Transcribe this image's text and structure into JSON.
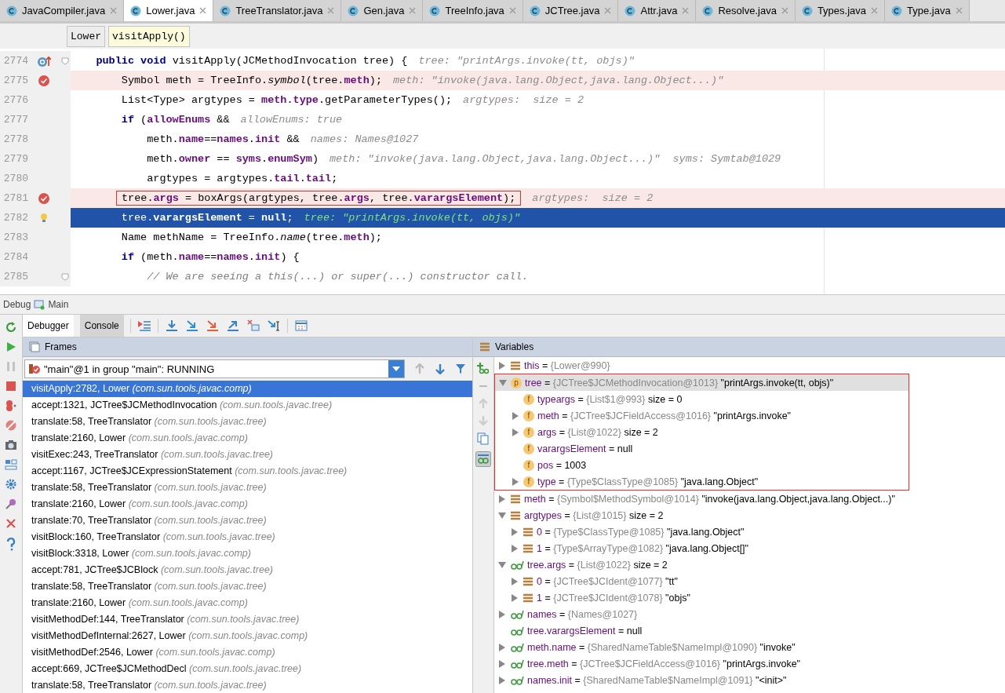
{
  "tabs": [
    {
      "label": "JavaCompiler.java",
      "selected": false
    },
    {
      "label": "Lower.java",
      "selected": true
    },
    {
      "label": "TreeTranslator.java",
      "selected": false
    },
    {
      "label": "Gen.java",
      "selected": false
    },
    {
      "label": "TreeInfo.java",
      "selected": false
    },
    {
      "label": "JCTree.java",
      "selected": false
    },
    {
      "label": "Attr.java",
      "selected": false
    },
    {
      "label": "Resolve.java",
      "selected": false
    },
    {
      "label": "Types.java",
      "selected": false
    },
    {
      "label": "Type.java",
      "selected": false
    }
  ],
  "breadcrumbs": [
    {
      "label": "Lower",
      "selected": false
    },
    {
      "label": "visitApply()",
      "selected": true
    }
  ],
  "code_lines": [
    {
      "number": "2774",
      "override": true,
      "breakpoint": false,
      "bulb": false,
      "current": false,
      "fold": true,
      "boxed": false,
      "segments": [
        {
          "t": "    public void",
          "kind": "kw"
        },
        {
          "t": " visitApply(JCMethodInvocation tree) {",
          "kind": "plain"
        }
      ],
      "hint": "tree: \"printArgs.invoke(tt, objs)\""
    },
    {
      "number": "2775",
      "override": false,
      "breakpoint": true,
      "bulb": false,
      "current": false,
      "fold": false,
      "boxed": false,
      "segments": [
        {
          "t": "        Symbol meth = TreeInfo.",
          "kind": "plain"
        },
        {
          "t": "symbol",
          "kind": "static"
        },
        {
          "t": "(tree.",
          "kind": "plain"
        },
        {
          "t": "meth",
          "kind": "field"
        },
        {
          "t": ");",
          "kind": "plain"
        }
      ],
      "hint": "meth: \"invoke(java.lang.Object,java.lang.Object...)\""
    },
    {
      "number": "2776",
      "override": false,
      "breakpoint": false,
      "bulb": false,
      "current": false,
      "fold": false,
      "boxed": false,
      "segments": [
        {
          "t": "        List<Type> argtypes = ",
          "kind": "plain"
        },
        {
          "t": "meth",
          "kind": "field"
        },
        {
          "t": ".",
          "kind": "plain"
        },
        {
          "t": "type",
          "kind": "field"
        },
        {
          "t": ".getParameterTypes();",
          "kind": "plain"
        }
      ],
      "hint": "argtypes:  size = 2"
    },
    {
      "number": "2777",
      "override": false,
      "breakpoint": false,
      "bulb": false,
      "current": false,
      "fold": false,
      "boxed": false,
      "segments": [
        {
          "t": "        if",
          "kind": "kw"
        },
        {
          "t": " (",
          "kind": "plain"
        },
        {
          "t": "allowEnums",
          "kind": "field"
        },
        {
          "t": " &&",
          "kind": "plain"
        }
      ],
      "hint": "allowEnums: true"
    },
    {
      "number": "2778",
      "override": false,
      "breakpoint": false,
      "bulb": false,
      "current": false,
      "fold": false,
      "boxed": false,
      "segments": [
        {
          "t": "            meth.",
          "kind": "plain"
        },
        {
          "t": "name",
          "kind": "field"
        },
        {
          "t": "==",
          "kind": "plain"
        },
        {
          "t": "names",
          "kind": "field"
        },
        {
          "t": ".",
          "kind": "plain"
        },
        {
          "t": "init",
          "kind": "field"
        },
        {
          "t": " &&",
          "kind": "plain"
        }
      ],
      "hint": "names: Names@1027"
    },
    {
      "number": "2779",
      "override": false,
      "breakpoint": false,
      "bulb": false,
      "current": false,
      "fold": false,
      "boxed": false,
      "segments": [
        {
          "t": "            meth.",
          "kind": "plain"
        },
        {
          "t": "owner",
          "kind": "field"
        },
        {
          "t": " == ",
          "kind": "plain"
        },
        {
          "t": "syms",
          "kind": "field"
        },
        {
          "t": ".",
          "kind": "plain"
        },
        {
          "t": "enumSym",
          "kind": "field"
        },
        {
          "t": ")",
          "kind": "plain"
        }
      ],
      "hint": "meth: \"invoke(java.lang.Object,java.lang.Object...)\"  syms: Symtab@1029"
    },
    {
      "number": "2780",
      "override": false,
      "breakpoint": false,
      "bulb": false,
      "current": false,
      "fold": false,
      "boxed": false,
      "segments": [
        {
          "t": "            argtypes = argtypes.",
          "kind": "plain"
        },
        {
          "t": "tail",
          "kind": "field"
        },
        {
          "t": ".",
          "kind": "plain"
        },
        {
          "t": "tail",
          "kind": "field"
        },
        {
          "t": ";",
          "kind": "plain"
        }
      ]
    },
    {
      "number": "2781",
      "override": false,
      "breakpoint": true,
      "bulb": false,
      "current": false,
      "fold": false,
      "boxed": true,
      "segments": [
        {
          "t": "tree.",
          "kind": "plain"
        },
        {
          "t": "args",
          "kind": "field"
        },
        {
          "t": " = boxArgs(argtypes, tree.",
          "kind": "plain"
        },
        {
          "t": "args",
          "kind": "field"
        },
        {
          "t": ", tree.",
          "kind": "plain"
        },
        {
          "t": "varargsElement",
          "kind": "field"
        },
        {
          "t": ");",
          "kind": "plain"
        }
      ],
      "hint": "argtypes:  size = 2"
    },
    {
      "number": "2782",
      "override": false,
      "breakpoint": false,
      "bulb": true,
      "current": true,
      "fold": false,
      "boxed": false,
      "segments": [
        {
          "t": "        tree.",
          "kind": "plain"
        },
        {
          "t": "varargsElement",
          "kind": "field"
        },
        {
          "t": " = ",
          "kind": "plain"
        },
        {
          "t": "null",
          "kind": "kw"
        },
        {
          "t": ";",
          "kind": "plain"
        }
      ],
      "hint": "tree: \"printArgs.invoke(tt, objs)\""
    },
    {
      "number": "2783",
      "override": false,
      "breakpoint": false,
      "bulb": false,
      "current": false,
      "fold": false,
      "boxed": false,
      "segments": [
        {
          "t": "        Name methName = TreeInfo.",
          "kind": "plain"
        },
        {
          "t": "name",
          "kind": "static"
        },
        {
          "t": "(tree.",
          "kind": "plain"
        },
        {
          "t": "meth",
          "kind": "field"
        },
        {
          "t": ");",
          "kind": "plain"
        }
      ]
    },
    {
      "number": "2784",
      "override": false,
      "breakpoint": false,
      "bulb": false,
      "current": false,
      "fold": false,
      "boxed": false,
      "segments": [
        {
          "t": "        if",
          "kind": "kw"
        },
        {
          "t": " (meth.",
          "kind": "plain"
        },
        {
          "t": "name",
          "kind": "field"
        },
        {
          "t": "==",
          "kind": "plain"
        },
        {
          "t": "names",
          "kind": "field"
        },
        {
          "t": ".",
          "kind": "plain"
        },
        {
          "t": "init",
          "kind": "field"
        },
        {
          "t": ") {",
          "kind": "plain"
        }
      ]
    },
    {
      "number": "2785",
      "override": false,
      "breakpoint": false,
      "bulb": false,
      "current": false,
      "fold": true,
      "boxed": false,
      "segments": [
        {
          "t": "            // We are seeing a this(...) or super(...) constructor call.",
          "kind": "comment"
        }
      ]
    }
  ],
  "debug": {
    "title": "Debug",
    "config": "Main",
    "tabs": [
      {
        "label": "Debugger",
        "selected": true
      },
      {
        "label": "Console",
        "selected": false
      }
    ]
  },
  "frames": {
    "title": "Frames",
    "thread": "\"main\"@1 in group \"main\": RUNNING",
    "items": [
      {
        "method": "visitApply:2782, Lower",
        "package": "(com.sun.tools.javac.comp)",
        "selected": true
      },
      {
        "method": "accept:1321, JCTree$JCMethodInvocation",
        "package": "(com.sun.tools.javac.tree)",
        "selected": false
      },
      {
        "method": "translate:58, TreeTranslator",
        "package": "(com.sun.tools.javac.tree)",
        "selected": false
      },
      {
        "method": "translate:2160, Lower",
        "package": "(com.sun.tools.javac.comp)",
        "selected": false
      },
      {
        "method": "visitExec:243, TreeTranslator",
        "package": "(com.sun.tools.javac.tree)",
        "selected": false
      },
      {
        "method": "accept:1167, JCTree$JCExpressionStatement",
        "package": "(com.sun.tools.javac.tree)",
        "selected": false
      },
      {
        "method": "translate:58, TreeTranslator",
        "package": "(com.sun.tools.javac.tree)",
        "selected": false
      },
      {
        "method": "translate:2160, Lower",
        "package": "(com.sun.tools.javac.comp)",
        "selected": false
      },
      {
        "method": "translate:70, TreeTranslator",
        "package": "(com.sun.tools.javac.tree)",
        "selected": false
      },
      {
        "method": "visitBlock:160, TreeTranslator",
        "package": "(com.sun.tools.javac.tree)",
        "selected": false
      },
      {
        "method": "visitBlock:3318, Lower",
        "package": "(com.sun.tools.javac.comp)",
        "selected": false
      },
      {
        "method": "accept:781, JCTree$JCBlock",
        "package": "(com.sun.tools.javac.tree)",
        "selected": false
      },
      {
        "method": "translate:58, TreeTranslator",
        "package": "(com.sun.tools.javac.tree)",
        "selected": false
      },
      {
        "method": "translate:2160, Lower",
        "package": "(com.sun.tools.javac.comp)",
        "selected": false
      },
      {
        "method": "visitMethodDef:144, TreeTranslator",
        "package": "(com.sun.tools.javac.tree)",
        "selected": false
      },
      {
        "method": "visitMethodDefInternal:2627, Lower",
        "package": "(com.sun.tools.javac.comp)",
        "selected": false
      },
      {
        "method": "visitMethodDef:2546, Lower",
        "package": "(com.sun.tools.javac.comp)",
        "selected": false
      },
      {
        "method": "accept:669, JCTree$JCMethodDecl",
        "package": "(com.sun.tools.javac.tree)",
        "selected": false
      },
      {
        "method": "translate:58, TreeTranslator",
        "package": "(com.sun.tools.javac.tree)",
        "selected": false
      }
    ]
  },
  "variables": {
    "title": "Variables",
    "items": [
      {
        "kind": "object",
        "name": "this",
        "sep": "=",
        "ref": "{Lower@990}",
        "expandable": true,
        "expanded": false,
        "selected": false,
        "highlighted": false
      },
      {
        "kind": "badge",
        "badge": "p",
        "name": "tree",
        "sep": "=",
        "ref": "{JCTree$JCMethodInvocation@1013}",
        "value": "\"printArgs.invoke(tt, objs)\"",
        "expandable": true,
        "expanded": true,
        "selected": true,
        "highlighted": true,
        "children": [
          {
            "kind": "badge",
            "badge": "f",
            "name": "typeargs",
            "sep": "=",
            "ref": "{List$1@993}",
            "value": "size = 0",
            "expandable": false,
            "selected": false
          },
          {
            "kind": "badge",
            "badge": "f",
            "name": "meth",
            "sep": "=",
            "ref": "{JCTree$JCFieldAccess@1016}",
            "value": "\"printArgs.invoke\"",
            "expandable": true,
            "expanded": false,
            "selected": false
          },
          {
            "kind": "badge",
            "badge": "f",
            "name": "args",
            "sep": "=",
            "ref": "{List@1022}",
            "value": "size = 2",
            "expandable": true,
            "expanded": false,
            "selected": false
          },
          {
            "kind": "badge",
            "badge": "f",
            "name": "varargsElement",
            "sep": "=",
            "value": "null",
            "expandable": false,
            "selected": false
          },
          {
            "kind": "badge",
            "badge": "f",
            "name": "pos",
            "sep": "=",
            "value": "1003",
            "expandable": false,
            "selected": false
          },
          {
            "kind": "badge",
            "badge": "f",
            "name": "type",
            "sep": "=",
            "ref": "{Type$ClassType@1085}",
            "value": "\"java.lang.Object\"",
            "expandable": true,
            "expanded": false,
            "selected": false
          }
        ]
      },
      {
        "kind": "object",
        "name": "meth",
        "sep": "=",
        "ref": "{Symbol$MethodSymbol@1014}",
        "value": "\"invoke(java.lang.Object,java.lang.Object...)\"",
        "expandable": true,
        "expanded": false,
        "selected": false,
        "highlighted": false
      },
      {
        "kind": "object",
        "name": "argtypes",
        "sep": "=",
        "ref": "{List@1015}",
        "value": "size = 2",
        "expandable": true,
        "expanded": true,
        "selected": false,
        "highlighted": false,
        "children": [
          {
            "kind": "object",
            "name": "0",
            "sep": "=",
            "ref": "{Type$ClassType@1085}",
            "value": "\"java.lang.Object\"",
            "expandable": true,
            "expanded": false,
            "selected": false
          },
          {
            "kind": "object",
            "name": "1",
            "sep": "=",
            "ref": "{Type$ArrayType@1082}",
            "value": "\"java.lang.Object[]\"",
            "expandable": true,
            "expanded": false,
            "selected": false
          }
        ]
      },
      {
        "kind": "watch",
        "name": "tree.args",
        "sep": "=",
        "ref": "{List@1022}",
        "value": "size = 2",
        "expandable": true,
        "expanded": true,
        "selected": false,
        "highlighted": false,
        "children": [
          {
            "kind": "object",
            "name": "0",
            "sep": "=",
            "ref": "{JCTree$JCIdent@1077}",
            "value": "\"tt\"",
            "expandable": true,
            "expanded": false,
            "selected": false
          },
          {
            "kind": "object",
            "name": "1",
            "sep": "=",
            "ref": "{JCTree$JCIdent@1078}",
            "value": "\"objs\"",
            "expandable": true,
            "expanded": false,
            "selected": false
          }
        ]
      },
      {
        "kind": "watch",
        "name": "names",
        "sep": "=",
        "ref": "{Names@1027}",
        "expandable": true,
        "expanded": false,
        "selected": false,
        "highlighted": false
      },
      {
        "kind": "watch",
        "name": "tree.varargsElement",
        "sep": "=",
        "value": "null",
        "expandable": false,
        "selected": false,
        "highlighted": false
      },
      {
        "kind": "watch",
        "name": "meth.name",
        "sep": "=",
        "ref": "{SharedNameTable$NameImpl@1090}",
        "value": "\"invoke\"",
        "expandable": true,
        "expanded": false,
        "selected": false,
        "highlighted": false
      },
      {
        "kind": "watch",
        "name": "tree.meth",
        "sep": "=",
        "ref": "{JCTree$JCFieldAccess@1016}",
        "value": "\"printArgs.invoke\"",
        "expandable": true,
        "expanded": false,
        "selected": false,
        "highlighted": false
      },
      {
        "kind": "watch",
        "name": "names.init",
        "sep": "=",
        "ref": "{SharedNameTable$NameImpl@1091}",
        "value": "\"<init>\"",
        "expandable": true,
        "expanded": false,
        "selected": false,
        "highlighted": false
      }
    ]
  }
}
